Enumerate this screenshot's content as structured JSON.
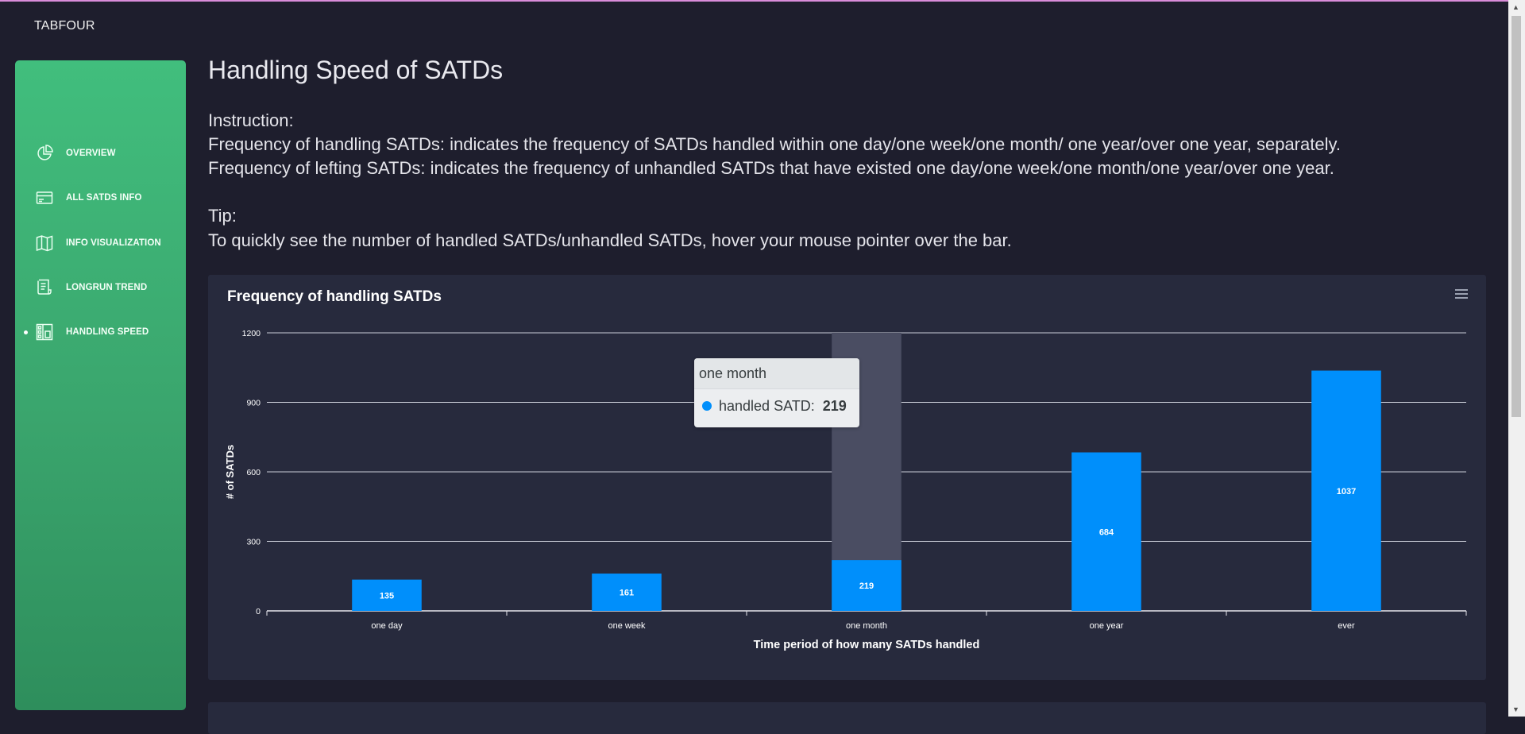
{
  "brand": "TABFOUR",
  "sidebar": {
    "items": [
      {
        "label": "OVERVIEW",
        "icon": "pie-chart-icon"
      },
      {
        "label": "ALL SATDS INFO",
        "icon": "card-icon"
      },
      {
        "label": "INFO VISUALIZATION",
        "icon": "map-icon"
      },
      {
        "label": "LONGRUN TREND",
        "icon": "document-icon"
      },
      {
        "label": "HANDLING SPEED",
        "icon": "building-icon",
        "active": true
      }
    ]
  },
  "main": {
    "title": "Handling Speed of SATDs",
    "instruction_heading": "Instruction:",
    "instruction_1": "Frequency of handling SATDs: indicates the frequency of SATDs handled within one day/one week/one month/ one year/over one year, separately.",
    "instruction_2": "Frequency of lefting SATDs: indicates the frequency of unhandled SATDs that have existed one day/one week/one month/one year/over one year.",
    "tip_heading": "Tip:",
    "tip_text": "To quickly see the number of handled SATDs/unhandled SATDs, hover your mouse pointer over the bar."
  },
  "tooltip": {
    "title": "one month",
    "series": "handled SATD:",
    "value": "219"
  },
  "colors": {
    "bar": "#008ffb",
    "sidebar": "#41be7d",
    "background": "#1e1e2d",
    "card": "#272a3d"
  },
  "chart_data": {
    "type": "bar",
    "title": "Frequency of handling SATDs",
    "xlabel": "Time period of how many SATDs handled",
    "ylabel": "# of SATDs",
    "categories": [
      "one day",
      "one week",
      "one month",
      "one year",
      "ever"
    ],
    "series": [
      {
        "name": "handled SATD",
        "values": [
          135,
          161,
          219,
          684,
          1037
        ]
      }
    ],
    "ylim": [
      0,
      1200
    ],
    "yticks": [
      0,
      300,
      600,
      900,
      1200
    ],
    "grid": true,
    "highlighted_category": "one month"
  }
}
